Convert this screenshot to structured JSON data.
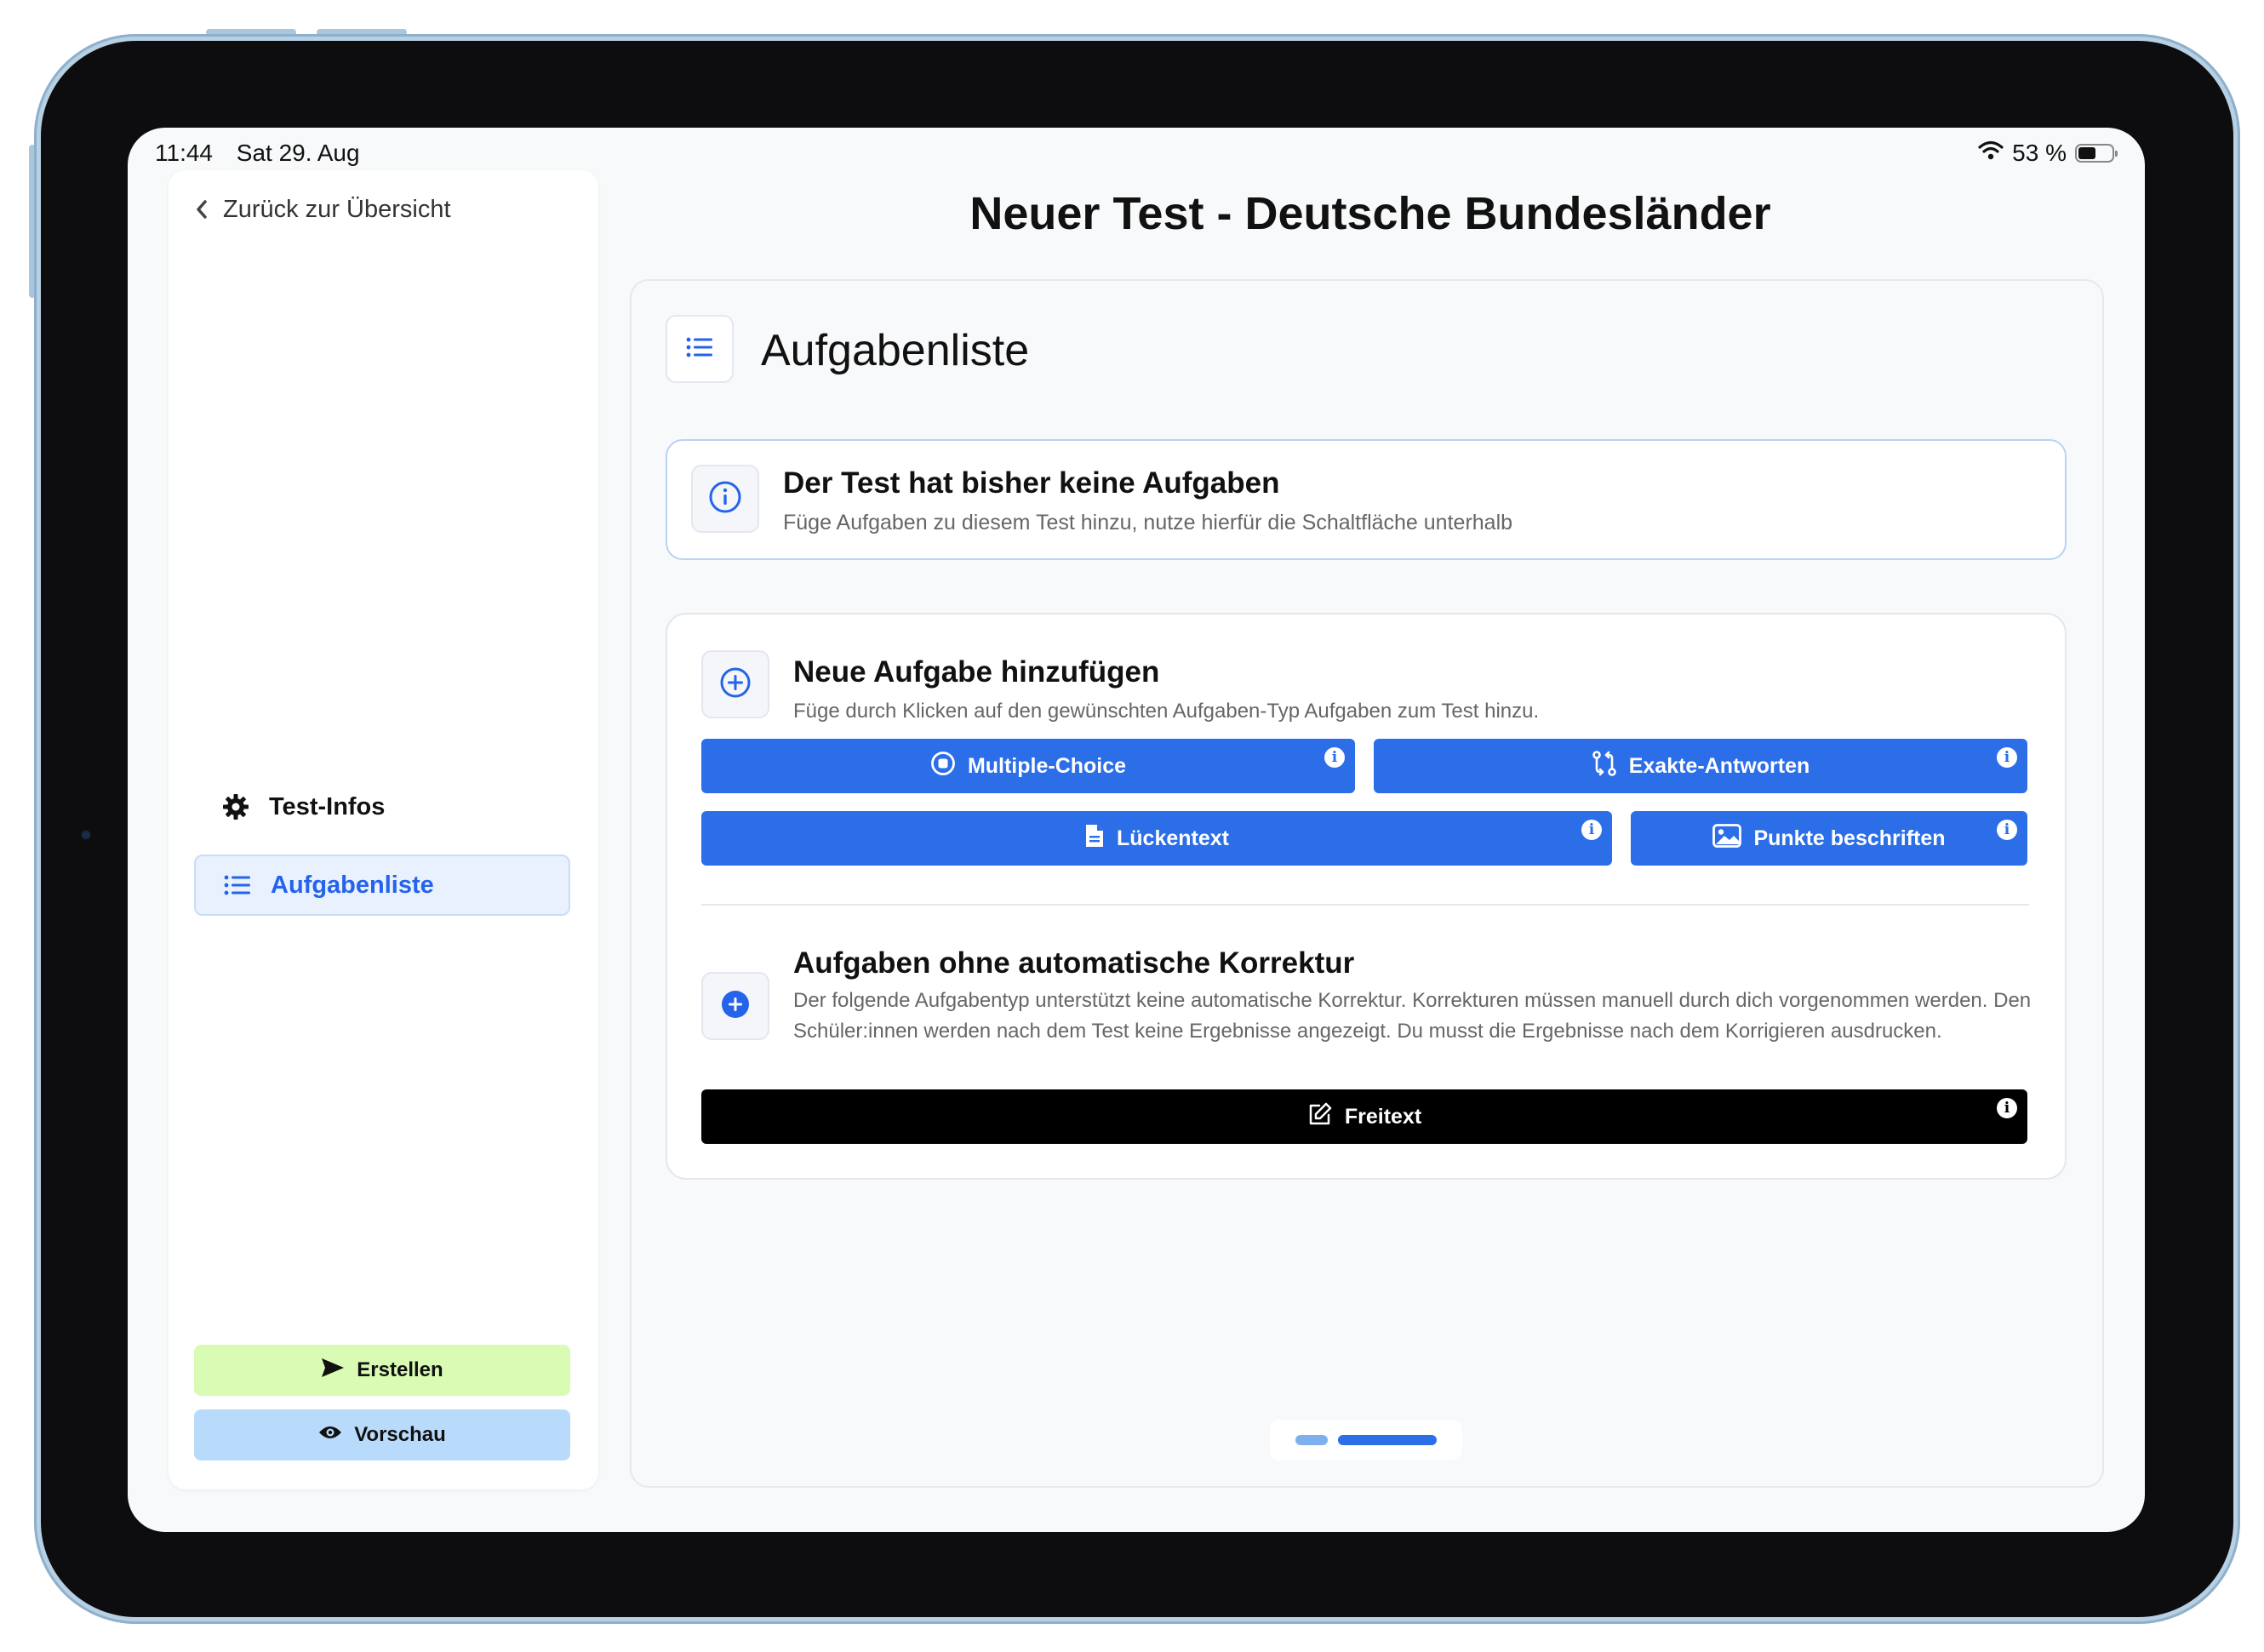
{
  "status_bar": {
    "time": "11:44",
    "date": "Sat 29. Aug",
    "battery": "53 %",
    "battery_level": 0.53
  },
  "sidebar": {
    "back_label": "Zurück zur Übersicht",
    "items": [
      {
        "label": "Test-Infos",
        "icon": "gear-icon",
        "active": false
      },
      {
        "label": "Aufgabenliste",
        "icon": "list-icon",
        "active": true
      }
    ],
    "create_label": "Erstellen",
    "preview_label": "Vorschau"
  },
  "main": {
    "title": "Neuer Test - Deutsche Bundesländer",
    "section_title": "Aufgabenliste",
    "info": {
      "title": "Der Test hat bisher keine Aufgaben",
      "description": "Füge Aufgaben zu diesem Test hinzu, nutze hierfür die Schaltfläche unterhalb"
    },
    "add": {
      "title": "Neue Aufgabe hinzufügen",
      "description": "Füge durch Klicken auf den gewünschten Aufgaben-Typ Aufgaben zum Test hinzu.",
      "types": [
        {
          "label": "Multiple-Choice",
          "icon": "radio-icon"
        },
        {
          "label": "Exakte-Antworten",
          "icon": "swap-icon"
        },
        {
          "label": "Lückentext",
          "icon": "document-icon"
        },
        {
          "label": "Punkte beschriften",
          "icon": "image-icon"
        }
      ]
    },
    "manual": {
      "title": "Aufgaben ohne automatische Korrektur",
      "description": "Der folgende Aufgabentyp unterstützt keine automatische Korrektur. Korrekturen müssen manuell durch dich vorgenommen werden. Den Schüler:innen werden nach dem Test keine Ergebnisse angezeigt. Du musst die Ergebnisse nach dem Korrigieren ausdrucken.",
      "button": {
        "label": "Freitext",
        "icon": "edit-icon"
      }
    },
    "info_glyph": "i"
  },
  "colors": {
    "accent": "#2b6ee8",
    "create": "#d9fbb4",
    "preview": "#b9dbfb"
  }
}
